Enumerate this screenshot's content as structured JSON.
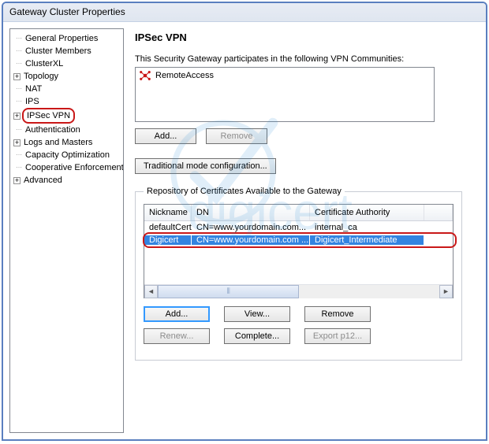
{
  "window": {
    "title": "Gateway Cluster Properties"
  },
  "sidebar": {
    "items": [
      {
        "label": "General Properties",
        "expandable": false
      },
      {
        "label": "Cluster Members",
        "expandable": false
      },
      {
        "label": "ClusterXL",
        "expandable": false
      },
      {
        "label": "Topology",
        "expandable": true
      },
      {
        "label": "NAT",
        "expandable": false
      },
      {
        "label": "IPS",
        "expandable": false
      },
      {
        "label": "IPSec VPN",
        "expandable": true,
        "highlight": true
      },
      {
        "label": "Authentication",
        "expandable": false
      },
      {
        "label": "Logs and Masters",
        "expandable": true
      },
      {
        "label": "Capacity Optimization",
        "expandable": false
      },
      {
        "label": "Cooperative Enforcement",
        "expandable": false
      },
      {
        "label": "Advanced",
        "expandable": true
      }
    ]
  },
  "page": {
    "title": "IPSec VPN",
    "communities": {
      "description": "This Security Gateway participates in the following VPN Communities:",
      "items": [
        {
          "icon": "remote-access-icon",
          "name": "RemoteAccess"
        }
      ],
      "add_label": "Add...",
      "remove_label": "Remove"
    },
    "traditional_label": "Traditional mode configuration...",
    "repo": {
      "legend": "Repository of Certificates Available to the Gateway",
      "columns": {
        "nickname": "Nickname",
        "dn": "DN",
        "ca": "Certificate Authority"
      },
      "rows": [
        {
          "nickname": "defaultCert",
          "dn": "CN=www.yourdomain.com...",
          "ca": "internal_ca",
          "selected": false
        },
        {
          "nickname": "Digicert",
          "dn": "CN=www.yourdomain.com ...",
          "ca": "Digicert_Intermediate",
          "selected": true,
          "highlight": true
        }
      ],
      "buttons": {
        "add": "Add...",
        "view": "View...",
        "remove": "Remove",
        "renew": "Renew...",
        "complete": "Complete...",
        "export": "Export p12..."
      }
    }
  },
  "watermark": {
    "brand": "digicert"
  }
}
